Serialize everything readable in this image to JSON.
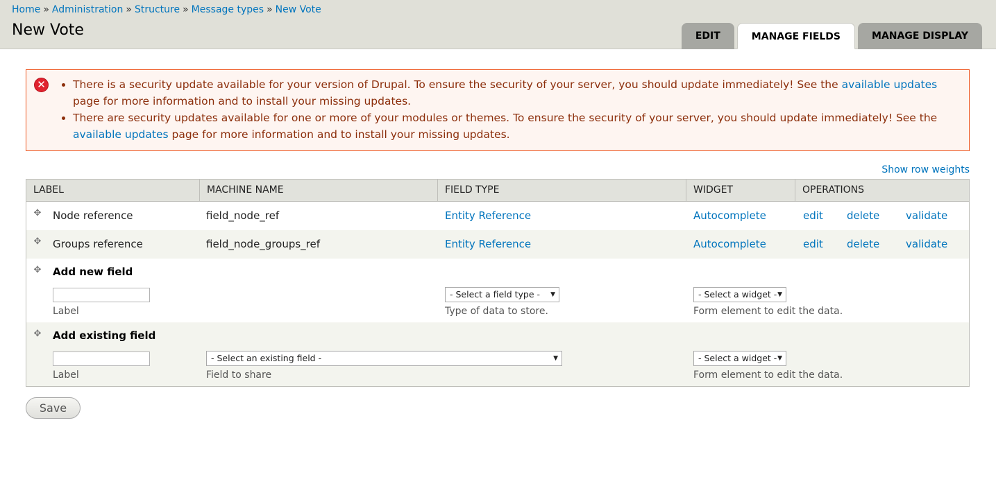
{
  "breadcrumb": [
    "Home",
    "Administration",
    "Structure",
    "Message types",
    "New Vote"
  ],
  "breadcrumb_sep": "»",
  "title": "New Vote",
  "tabs": [
    {
      "label": "EDIT",
      "active": false
    },
    {
      "label": "MANAGE FIELDS",
      "active": true
    },
    {
      "label": "MANAGE DISPLAY",
      "active": false
    }
  ],
  "messages": {
    "icon": "error-icon",
    "item1": {
      "before": "There is a security update available for your version of Drupal. To ensure the security of your server, you should update immediately! See the ",
      "link": "available updates",
      "after": " page for more information and to install your missing updates."
    },
    "item2": {
      "before": "There are security updates available for one or more of your modules or themes. To ensure the security of your server, you should update immediately! See the ",
      "link": "available updates",
      "after": " page for more information and to install your missing updates."
    }
  },
  "show_row_weights": "Show row weights",
  "table": {
    "headers": [
      "LABEL",
      "MACHINE NAME",
      "FIELD TYPE",
      "WIDGET",
      "OPERATIONS"
    ],
    "rows": [
      {
        "label": "Node reference",
        "machine": "field_node_ref",
        "type": "Entity Reference",
        "widget": "Autocomplete",
        "ops": [
          "edit",
          "delete",
          "validate"
        ]
      },
      {
        "label": "Groups reference",
        "machine": "field_node_groups_ref",
        "type": "Entity Reference",
        "widget": "Autocomplete",
        "ops": [
          "edit",
          "delete",
          "validate"
        ]
      }
    ],
    "add_new": {
      "title": "Add new field",
      "label_desc": "Label",
      "type_select": "- Select a field type -",
      "type_desc": "Type of data to store.",
      "widget_select": "- Select a widget -",
      "widget_desc": "Form element to edit the data."
    },
    "add_existing": {
      "title": "Add existing field",
      "label_desc": "Label",
      "field_select": "- Select an existing field -",
      "field_desc": "Field to share",
      "widget_select": "- Select a widget -",
      "widget_desc": "Form element to edit the data."
    }
  },
  "save_label": "Save"
}
